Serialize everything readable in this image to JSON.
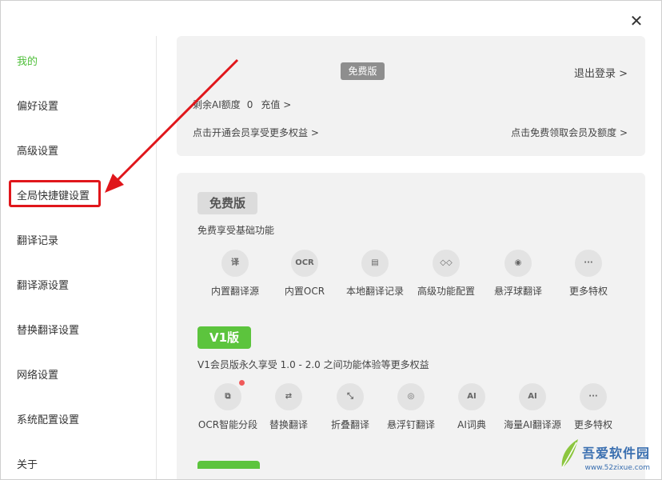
{
  "window": {
    "close_symbol": "✕"
  },
  "sidebar": {
    "items": [
      {
        "label": "我的",
        "active": true
      },
      {
        "label": "偏好设置"
      },
      {
        "label": "高级设置"
      },
      {
        "label": "全局快捷键设置"
      },
      {
        "label": "翻译记录"
      },
      {
        "label": "翻译源设置"
      },
      {
        "label": "替换翻译设置"
      },
      {
        "label": "网络设置"
      },
      {
        "label": "系统配置设置"
      },
      {
        "label": "关于"
      }
    ]
  },
  "account": {
    "plan_badge": "免费版",
    "logout": "退出登录 >",
    "quota_label": "剩余AI额度",
    "quota_value": "0",
    "recharge": "充值 >",
    "open_vip": "点击开通会员享受更多权益 >",
    "free_vip": "点击免费领取会员及额度 >"
  },
  "tiers": {
    "free": {
      "badge": "免费版",
      "desc": "免费享受基础功能",
      "features": [
        {
          "label": "内置翻译源",
          "icon": "译",
          "icon_name": "translate-icon"
        },
        {
          "label": "内置OCR",
          "icon": "OCR",
          "icon_name": "ocr-icon"
        },
        {
          "label": "本地翻译记录",
          "icon": "▤",
          "icon_name": "history-icon"
        },
        {
          "label": "高级功能配置",
          "icon": "◇◇",
          "icon_name": "advanced-config-icon"
        },
        {
          "label": "悬浮球翻译",
          "icon": "◉",
          "icon_name": "floating-ball-icon"
        },
        {
          "label": "更多特权",
          "icon": "···",
          "icon_name": "more-icon"
        }
      ]
    },
    "v1": {
      "badge": "V1版",
      "desc": "V1会员版永久享受 1.0 - 2.0 之间功能体验等更多权益",
      "features": [
        {
          "label": "OCR智能分段",
          "icon": "⧉",
          "icon_name": "ocr-segment-icon",
          "dot": true
        },
        {
          "label": "替换翻译",
          "icon": "⇄",
          "icon_name": "swap-translate-icon"
        },
        {
          "label": "折叠翻译",
          "icon": "⤡",
          "icon_name": "fold-translate-icon"
        },
        {
          "label": "悬浮钉翻译",
          "icon": "◎",
          "icon_name": "pin-translate-icon"
        },
        {
          "label": "AI词典",
          "icon": "AI",
          "icon_name": "ai-dictionary-icon"
        },
        {
          "label": "海量AI翻译源",
          "icon": "AI",
          "icon_name": "ai-source-icon"
        },
        {
          "label": "更多特权",
          "icon": "···",
          "icon_name": "more-icon"
        }
      ]
    }
  },
  "watermark": {
    "title": "吾爱软件园",
    "url": "www.52zixue.com"
  },
  "colors": {
    "accent": "#4fbf3a",
    "badge_green": "#5cc43d",
    "highlight_red": "#e0161b"
  }
}
